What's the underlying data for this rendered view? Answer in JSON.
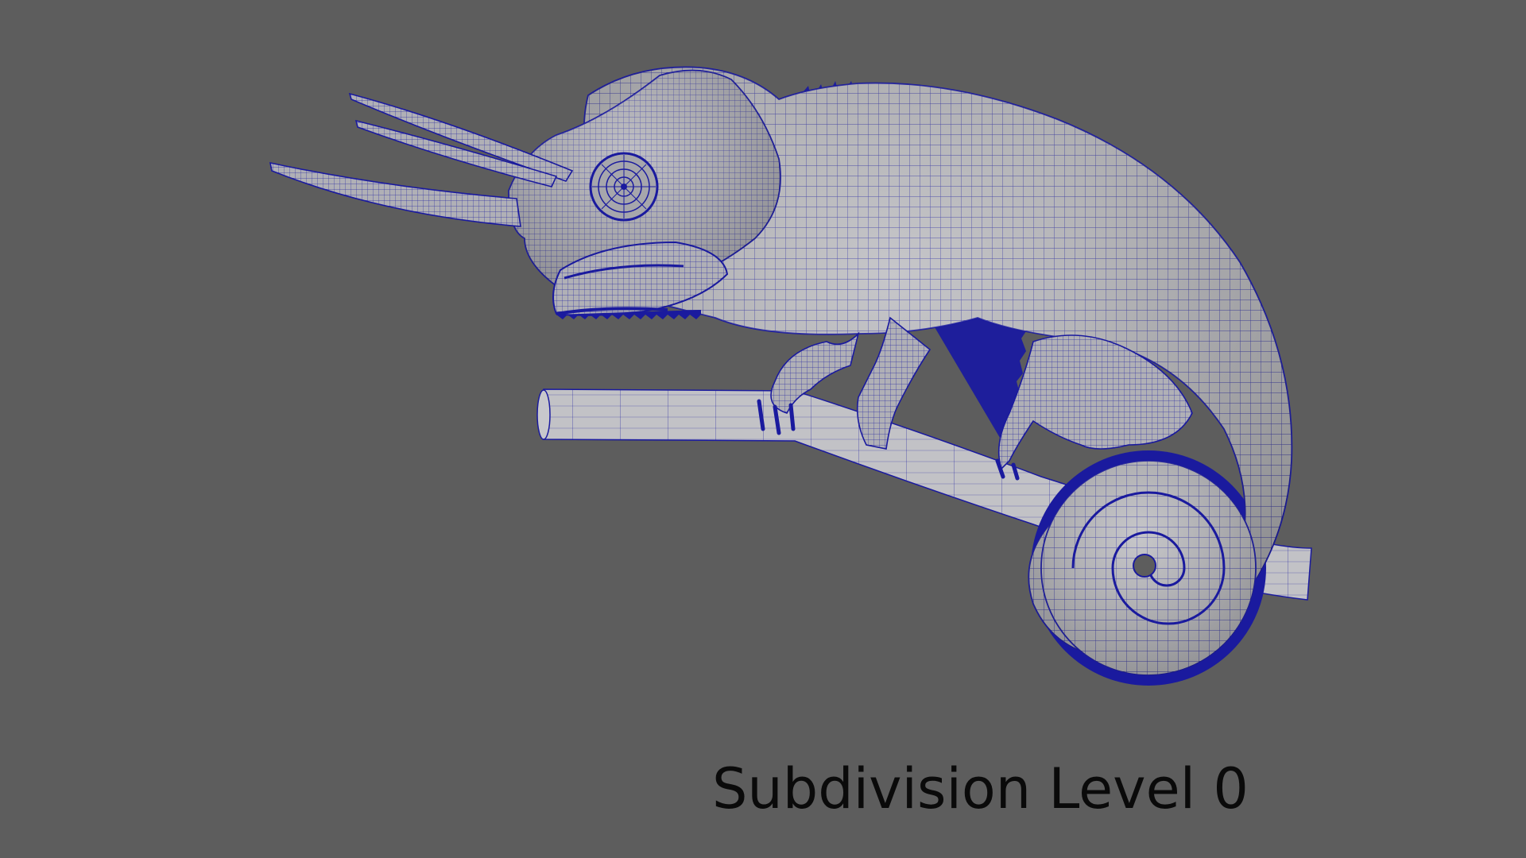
{
  "viewport": {
    "background_color": "#5d5d5d",
    "wire_color": "#1a1a9e",
    "surface_color": "#b9b9bd",
    "caption": "Subdivision Level 0"
  }
}
